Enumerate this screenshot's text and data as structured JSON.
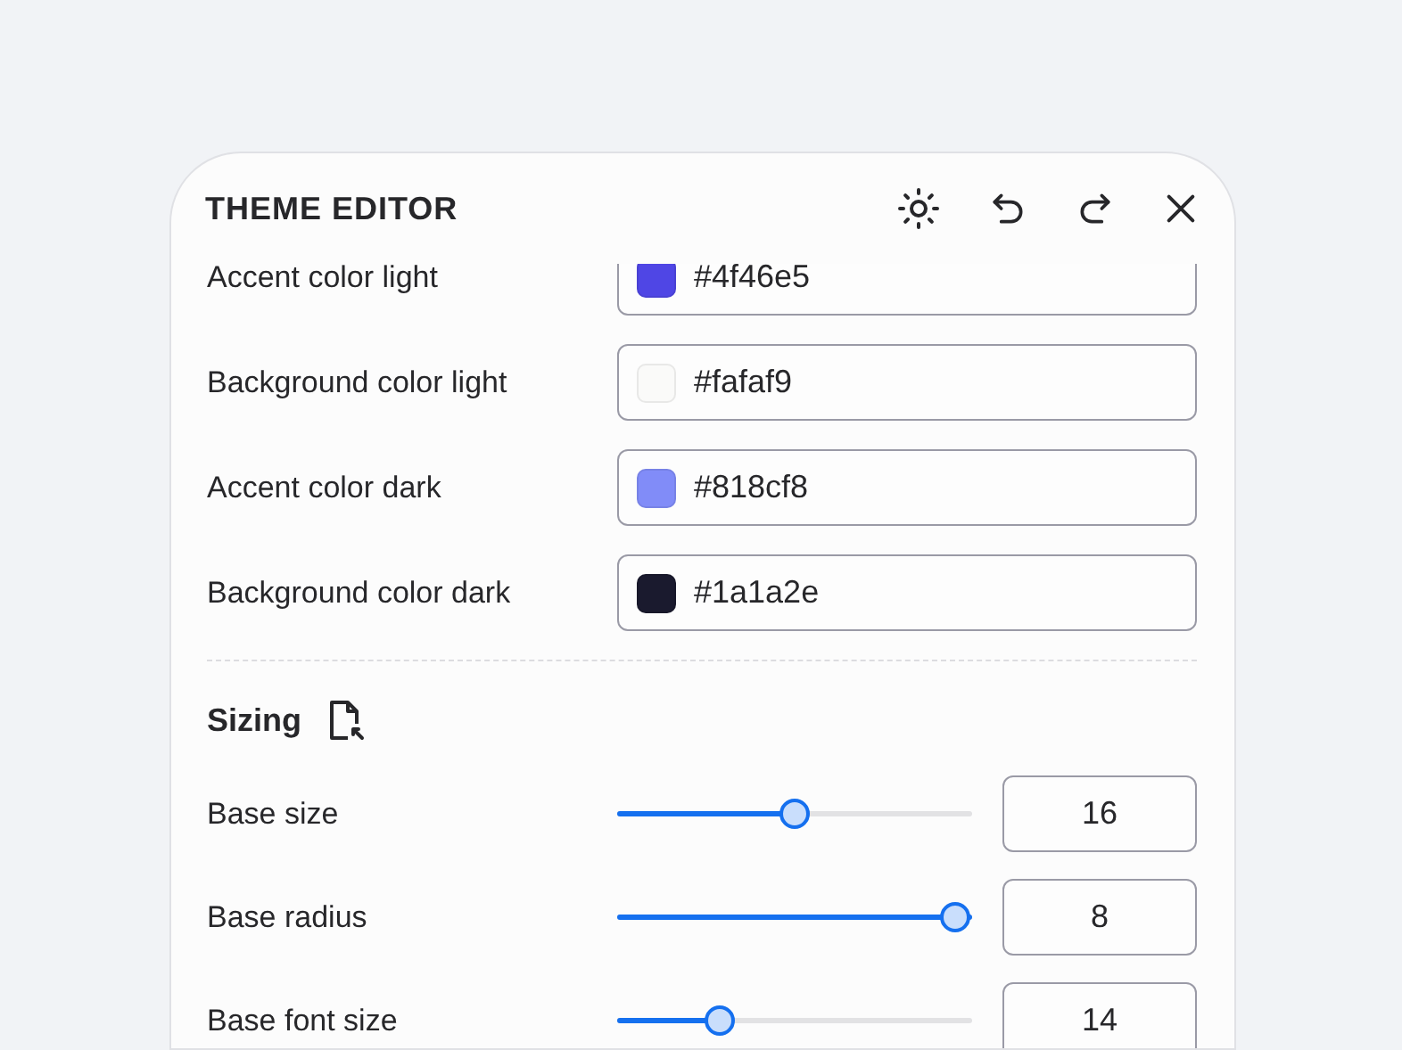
{
  "panel": {
    "title": "THEME EDITOR"
  },
  "colors": [
    {
      "label": "Accent color light",
      "value": "#4f46e5",
      "color": "#4f46e5"
    },
    {
      "label": "Background color light",
      "value": "#fafaf9",
      "color": "#fafaf9"
    },
    {
      "label": "Accent color dark",
      "value": "#818cf8",
      "color": "#818cf8"
    },
    {
      "label": "Background color dark",
      "value": "#1a1a2e",
      "color": "#1a1a2e"
    }
  ],
  "sizing": {
    "heading": "Sizing",
    "sliders": [
      {
        "label": "Base size",
        "level": 0.5,
        "value": "16"
      },
      {
        "label": "Base radius",
        "level": 1.0,
        "value": "8"
      },
      {
        "label": "Base font size",
        "level": 0.27,
        "value": "14"
      }
    ]
  }
}
